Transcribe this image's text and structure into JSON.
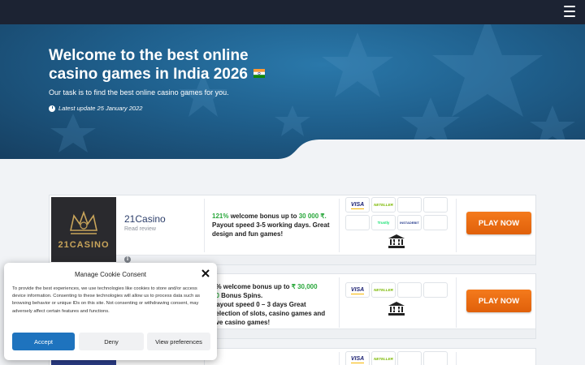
{
  "hero": {
    "title": "Welcome to the best online casino games in India 2026",
    "subtitle": "Our task is to find the best online casino games for you.",
    "latest_update": "Latest update 25 January 2022"
  },
  "casinos": [
    {
      "name": "21Casino",
      "logo_text": "21CASINO",
      "review_label": "Read review",
      "bonus_pct": "121%",
      "bonus_mid": " welcome bonus up to ",
      "bonus_amount": "30 000 ₹.",
      "bonus_rest": "Payout speed 3-5 working days. Great design and fun games!",
      "payments": [
        "VISA",
        "NETELLER",
        "",
        "",
        "",
        "Trustly",
        "INSTADEBIT",
        "",
        "BANK"
      ],
      "play_label": "PLAY NOW"
    },
    {
      "bonus_pct": "0%",
      "bonus_mid": " welcome bonus up to ",
      "bonus_amount": "₹ 30,000",
      "bonus_line2_num": "90",
      "bonus_line2_rest": " Bonus Spins.",
      "bonus_rest": "Payout speed 0 – 3 days Great selection of slots, casino games and live casino games!",
      "payments": [
        "VISA",
        "NETELLER",
        "",
        "",
        "BANK"
      ],
      "play_label": "PLAY NOW"
    },
    {
      "payments": [
        "VISA",
        "NETELLER",
        "",
        ""
      ]
    }
  ],
  "cookie": {
    "title": "Manage Cookie Consent",
    "text": "To provide the best experiences, we use technologies like cookies to store and/or access device information. Consenting to these technologies will allow us to process data such as browsing behavior or unique IDs on this site. Not consenting or withdrawing consent, may adversely affect certain features and functions.",
    "accept": "Accept",
    "deny": "Deny",
    "preferences": "View preferences"
  },
  "colors": {
    "topbar": "#1c2333",
    "hero": "#1f5f8c",
    "accent_orange": "#f47a1c",
    "bonus_green": "#2aa83c",
    "accept_blue": "#1e73be"
  }
}
